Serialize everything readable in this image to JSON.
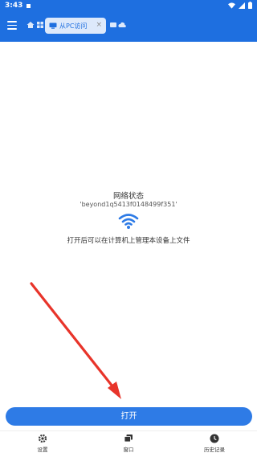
{
  "status_bar": {
    "time": "3:43"
  },
  "toolbar": {
    "tab_label": "从PC访问",
    "tab_close": "×"
  },
  "main": {
    "status_title": "网络状态",
    "network_id": "'beyond1q5413f0148499f351'",
    "description": "打开后可以在计算机上管理本设备上文件"
  },
  "open_button_label": "打开",
  "bottom_nav": [
    {
      "label": "设置",
      "icon": "gear-icon"
    },
    {
      "label": "窗口",
      "icon": "windows-icon"
    },
    {
      "label": "历史记录",
      "icon": "clock-icon"
    }
  ],
  "colors": {
    "primary": "#1e6fe0",
    "button": "#2e7be6",
    "annotation_arrow": "#e8342a"
  }
}
